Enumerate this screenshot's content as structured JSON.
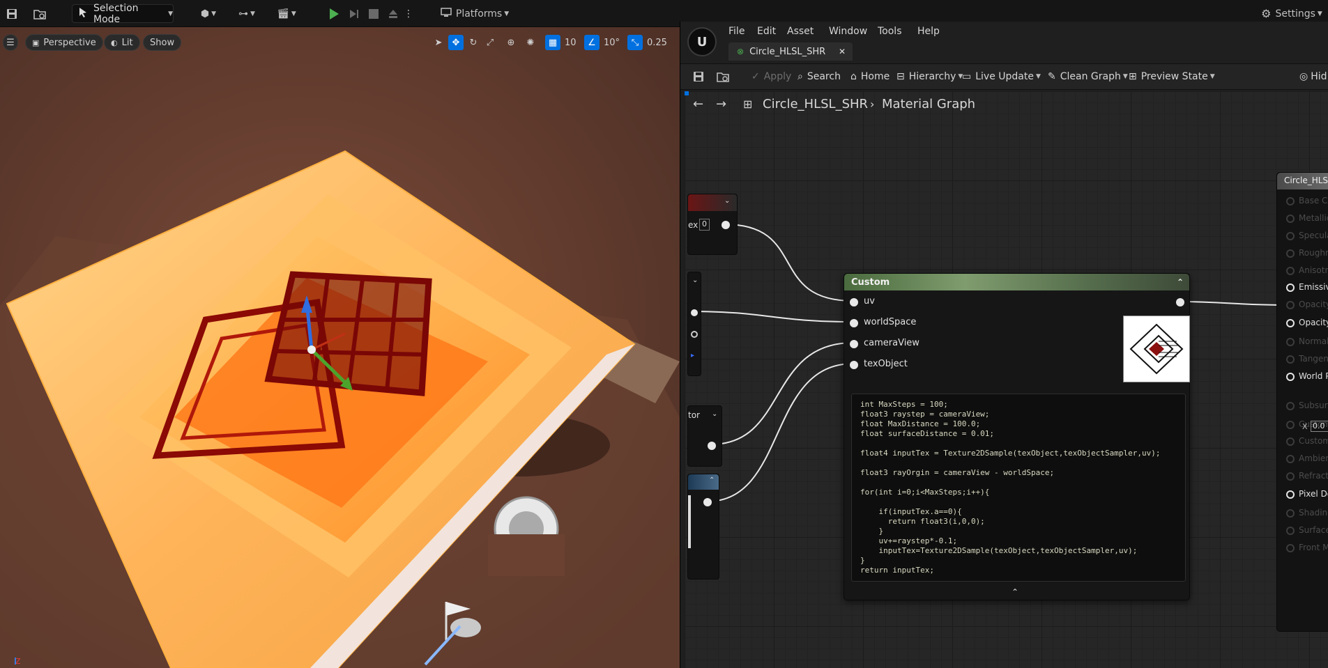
{
  "toolbar": {
    "selection_mode": "Selection Mode",
    "platforms": "Platforms",
    "settings": "Settings"
  },
  "viewport": {
    "perspective": "Perspective",
    "lit": "Lit",
    "show": "Show",
    "grid_snap": "10",
    "rotation_snap": "10°",
    "scale_snap": "0.25"
  },
  "editor": {
    "menus": [
      "File",
      "Edit",
      "Asset",
      "Window",
      "Tools",
      "Help"
    ],
    "tab_title": "Circle_HLSL_SHR",
    "toolbar": {
      "apply": "Apply",
      "search": "Search",
      "home": "Home",
      "hierarchy": "Hierarchy",
      "live_update": "Live Update",
      "clean_graph": "Clean Graph",
      "preview_state": "Preview State",
      "hide": "Hid"
    },
    "breadcrumb": {
      "asset": "Circle_HLSL_SHR",
      "graph": "Material Graph"
    }
  },
  "custom_node": {
    "title": "Custom",
    "inputs": [
      "uv",
      "worldSpace",
      "cameraView",
      "texObject"
    ],
    "code": "int MaxSteps = 100;\nfloat3 raystep = cameraView;\nfloat MaxDistance = 100.0;\nfloat surfaceDistance = 0.01;\n\nfloat4 inputTex = Texture2DSample(texObject,texObjectSampler,uv);\n\nfloat3 rayOrgin = cameraView - worldSpace;\n\nfor(int i=0;i<MaxSteps;i++){\n\n    if(inputTex.a==0){\n      return float3(i,0,0);\n    }\n    uv+=raystep*-0.1;\n    inputTex=Texture2DSample(texObject,texObjectSampler,uv);\n}\nreturn inputTex;"
  },
  "left_nodes": {
    "index_label": "ex",
    "index_value": "0",
    "vector_label": "tor"
  },
  "result_node": {
    "title": "Circle_HLS",
    "pins": [
      {
        "label": "Base Co",
        "active": false
      },
      {
        "label": "Metallic",
        "active": false
      },
      {
        "label": "Specula",
        "active": false
      },
      {
        "label": "Roughn",
        "active": false
      },
      {
        "label": "Anisotr",
        "active": false
      },
      {
        "label": "Emissiv",
        "active": true
      },
      {
        "label": "Opacity",
        "active": false
      },
      {
        "label": "Opacity",
        "active": true
      },
      {
        "label": "Normal",
        "active": false
      },
      {
        "label": "Tangen",
        "active": false
      },
      {
        "label": "World P",
        "active": true
      },
      {
        "label": "Subsurf",
        "active": false
      },
      {
        "label": "Custom",
        "active": false
      },
      {
        "label": "Custom",
        "active": false
      },
      {
        "label": "Ambien",
        "active": false
      },
      {
        "label": "Refracti",
        "active": false
      },
      {
        "label": "Pixel De",
        "active": true
      },
      {
        "label": "Shading",
        "active": false
      },
      {
        "label": "Surface",
        "active": false
      },
      {
        "label": "Front M",
        "active": false
      }
    ],
    "world_x_label": "X",
    "world_x_value": "0.0"
  },
  "colors": {
    "accent_blue": "#0070e0",
    "play_green": "#4caf50",
    "node_header_green": "#6f8c5f"
  }
}
